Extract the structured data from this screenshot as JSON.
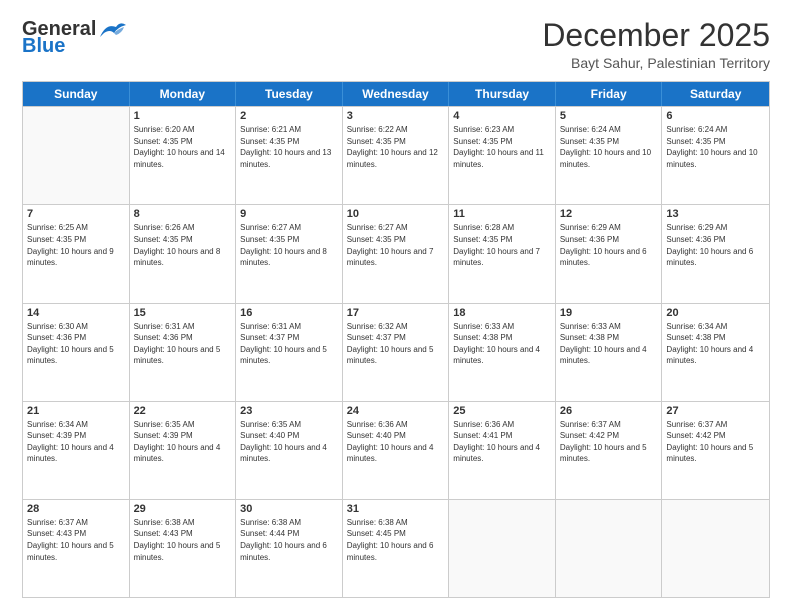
{
  "header": {
    "logo_line1": "General",
    "logo_line2": "Blue",
    "title": "December 2025",
    "subtitle": "Bayt Sahur, Palestinian Territory"
  },
  "days_of_week": [
    "Sunday",
    "Monday",
    "Tuesday",
    "Wednesday",
    "Thursday",
    "Friday",
    "Saturday"
  ],
  "weeks": [
    [
      {
        "day": "",
        "empty": true
      },
      {
        "day": "1",
        "sunrise": "6:20 AM",
        "sunset": "4:35 PM",
        "daylight": "10 hours and 14 minutes."
      },
      {
        "day": "2",
        "sunrise": "6:21 AM",
        "sunset": "4:35 PM",
        "daylight": "10 hours and 13 minutes."
      },
      {
        "day": "3",
        "sunrise": "6:22 AM",
        "sunset": "4:35 PM",
        "daylight": "10 hours and 12 minutes."
      },
      {
        "day": "4",
        "sunrise": "6:23 AM",
        "sunset": "4:35 PM",
        "daylight": "10 hours and 11 minutes."
      },
      {
        "day": "5",
        "sunrise": "6:24 AM",
        "sunset": "4:35 PM",
        "daylight": "10 hours and 10 minutes."
      },
      {
        "day": "6",
        "sunrise": "6:24 AM",
        "sunset": "4:35 PM",
        "daylight": "10 hours and 10 minutes."
      }
    ],
    [
      {
        "day": "7",
        "sunrise": "6:25 AM",
        "sunset": "4:35 PM",
        "daylight": "10 hours and 9 minutes."
      },
      {
        "day": "8",
        "sunrise": "6:26 AM",
        "sunset": "4:35 PM",
        "daylight": "10 hours and 8 minutes."
      },
      {
        "day": "9",
        "sunrise": "6:27 AM",
        "sunset": "4:35 PM",
        "daylight": "10 hours and 8 minutes."
      },
      {
        "day": "10",
        "sunrise": "6:27 AM",
        "sunset": "4:35 PM",
        "daylight": "10 hours and 7 minutes."
      },
      {
        "day": "11",
        "sunrise": "6:28 AM",
        "sunset": "4:35 PM",
        "daylight": "10 hours and 7 minutes."
      },
      {
        "day": "12",
        "sunrise": "6:29 AM",
        "sunset": "4:36 PM",
        "daylight": "10 hours and 6 minutes."
      },
      {
        "day": "13",
        "sunrise": "6:29 AM",
        "sunset": "4:36 PM",
        "daylight": "10 hours and 6 minutes."
      }
    ],
    [
      {
        "day": "14",
        "sunrise": "6:30 AM",
        "sunset": "4:36 PM",
        "daylight": "10 hours and 5 minutes."
      },
      {
        "day": "15",
        "sunrise": "6:31 AM",
        "sunset": "4:36 PM",
        "daylight": "10 hours and 5 minutes."
      },
      {
        "day": "16",
        "sunrise": "6:31 AM",
        "sunset": "4:37 PM",
        "daylight": "10 hours and 5 minutes."
      },
      {
        "day": "17",
        "sunrise": "6:32 AM",
        "sunset": "4:37 PM",
        "daylight": "10 hours and 5 minutes."
      },
      {
        "day": "18",
        "sunrise": "6:33 AM",
        "sunset": "4:38 PM",
        "daylight": "10 hours and 4 minutes."
      },
      {
        "day": "19",
        "sunrise": "6:33 AM",
        "sunset": "4:38 PM",
        "daylight": "10 hours and 4 minutes."
      },
      {
        "day": "20",
        "sunrise": "6:34 AM",
        "sunset": "4:38 PM",
        "daylight": "10 hours and 4 minutes."
      }
    ],
    [
      {
        "day": "21",
        "sunrise": "6:34 AM",
        "sunset": "4:39 PM",
        "daylight": "10 hours and 4 minutes."
      },
      {
        "day": "22",
        "sunrise": "6:35 AM",
        "sunset": "4:39 PM",
        "daylight": "10 hours and 4 minutes."
      },
      {
        "day": "23",
        "sunrise": "6:35 AM",
        "sunset": "4:40 PM",
        "daylight": "10 hours and 4 minutes."
      },
      {
        "day": "24",
        "sunrise": "6:36 AM",
        "sunset": "4:40 PM",
        "daylight": "10 hours and 4 minutes."
      },
      {
        "day": "25",
        "sunrise": "6:36 AM",
        "sunset": "4:41 PM",
        "daylight": "10 hours and 4 minutes."
      },
      {
        "day": "26",
        "sunrise": "6:37 AM",
        "sunset": "4:42 PM",
        "daylight": "10 hours and 5 minutes."
      },
      {
        "day": "27",
        "sunrise": "6:37 AM",
        "sunset": "4:42 PM",
        "daylight": "10 hours and 5 minutes."
      }
    ],
    [
      {
        "day": "28",
        "sunrise": "6:37 AM",
        "sunset": "4:43 PM",
        "daylight": "10 hours and 5 minutes."
      },
      {
        "day": "29",
        "sunrise": "6:38 AM",
        "sunset": "4:43 PM",
        "daylight": "10 hours and 5 minutes."
      },
      {
        "day": "30",
        "sunrise": "6:38 AM",
        "sunset": "4:44 PM",
        "daylight": "10 hours and 6 minutes."
      },
      {
        "day": "31",
        "sunrise": "6:38 AM",
        "sunset": "4:45 PM",
        "daylight": "10 hours and 6 minutes."
      },
      {
        "day": "",
        "empty": true
      },
      {
        "day": "",
        "empty": true
      },
      {
        "day": "",
        "empty": true
      }
    ]
  ]
}
